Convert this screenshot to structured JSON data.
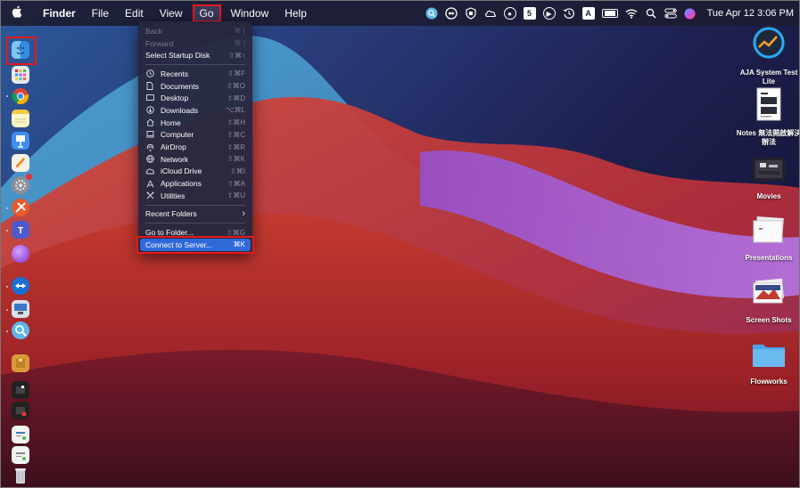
{
  "menubar": {
    "apple_icon": "apple-icon",
    "app_name": "Finder",
    "menus": [
      "File",
      "Edit",
      "View",
      "Go",
      "Window",
      "Help"
    ],
    "active_menu": "Go",
    "status_icons": [
      "search-globe-icon",
      "teamviewer-icon",
      "shield-icon",
      "creative-cloud-icon",
      "circle-icon",
      "five-icon",
      "play-icon",
      "time-machine-icon",
      "A",
      "battery-icon",
      "wifi-icon",
      "spotlight-icon",
      "control-center-icon",
      "siri-icon"
    ],
    "status_box_letter": "A",
    "status_five": "5",
    "clock": "Tue Apr 12  3:06 PM"
  },
  "go_menu": {
    "back": {
      "label": "Back",
      "shortcut": "⌘ ["
    },
    "forward": {
      "label": "Forward",
      "shortcut": "⌘ ]"
    },
    "startup": {
      "label": "Select Startup Disk",
      "shortcut": "⇧⌘↑"
    },
    "places": [
      {
        "label": "Recents",
        "shortcut": "⇧⌘F",
        "icon": "clock-icon"
      },
      {
        "label": "Documents",
        "shortcut": "⇧⌘O",
        "icon": "document-icon"
      },
      {
        "label": "Desktop",
        "shortcut": "⇧⌘D",
        "icon": "desktop-icon"
      },
      {
        "label": "Downloads",
        "shortcut": "⌥⌘L",
        "icon": "download-icon"
      },
      {
        "label": "Home",
        "shortcut": "⇧⌘H",
        "icon": "home-icon"
      },
      {
        "label": "Computer",
        "shortcut": "⇧⌘C",
        "icon": "computer-icon"
      },
      {
        "label": "AirDrop",
        "shortcut": "⇧⌘R",
        "icon": "airdrop-icon"
      },
      {
        "label": "Network",
        "shortcut": "⇧⌘K",
        "icon": "network-icon"
      },
      {
        "label": "iCloud Drive",
        "shortcut": "⇧⌘I",
        "icon": "cloud-icon"
      },
      {
        "label": "Applications",
        "shortcut": "⇧⌘A",
        "icon": "applications-icon"
      },
      {
        "label": "Utilities",
        "shortcut": "⇧⌘U",
        "icon": "utilities-icon"
      }
    ],
    "recent_folders": {
      "label": "Recent Folders",
      "arrow": "›"
    },
    "go_to_folder": {
      "label": "Go to Folder...",
      "shortcut": "⇧⌘G"
    },
    "connect": {
      "label": "Connect to Server...",
      "shortcut": "⌘K"
    }
  },
  "desktop": {
    "items": [
      {
        "label": "AJA System Test Lite",
        "icon": "aja-app-icon"
      },
      {
        "label": "Notes 無法開啟解決辦法",
        "icon": "document-thumbnail-icon"
      },
      {
        "label": "Movies",
        "icon": "movies-folder-icon"
      },
      {
        "label": "Presentations",
        "icon": "presentations-folder-icon"
      },
      {
        "label": "Screen Shots",
        "icon": "screenshots-folder-icon"
      },
      {
        "label": "Flowworks",
        "icon": "folder-icon"
      }
    ]
  },
  "colors": {
    "highlight": "#2f6ad8",
    "annotation": "#e41a1a"
  }
}
